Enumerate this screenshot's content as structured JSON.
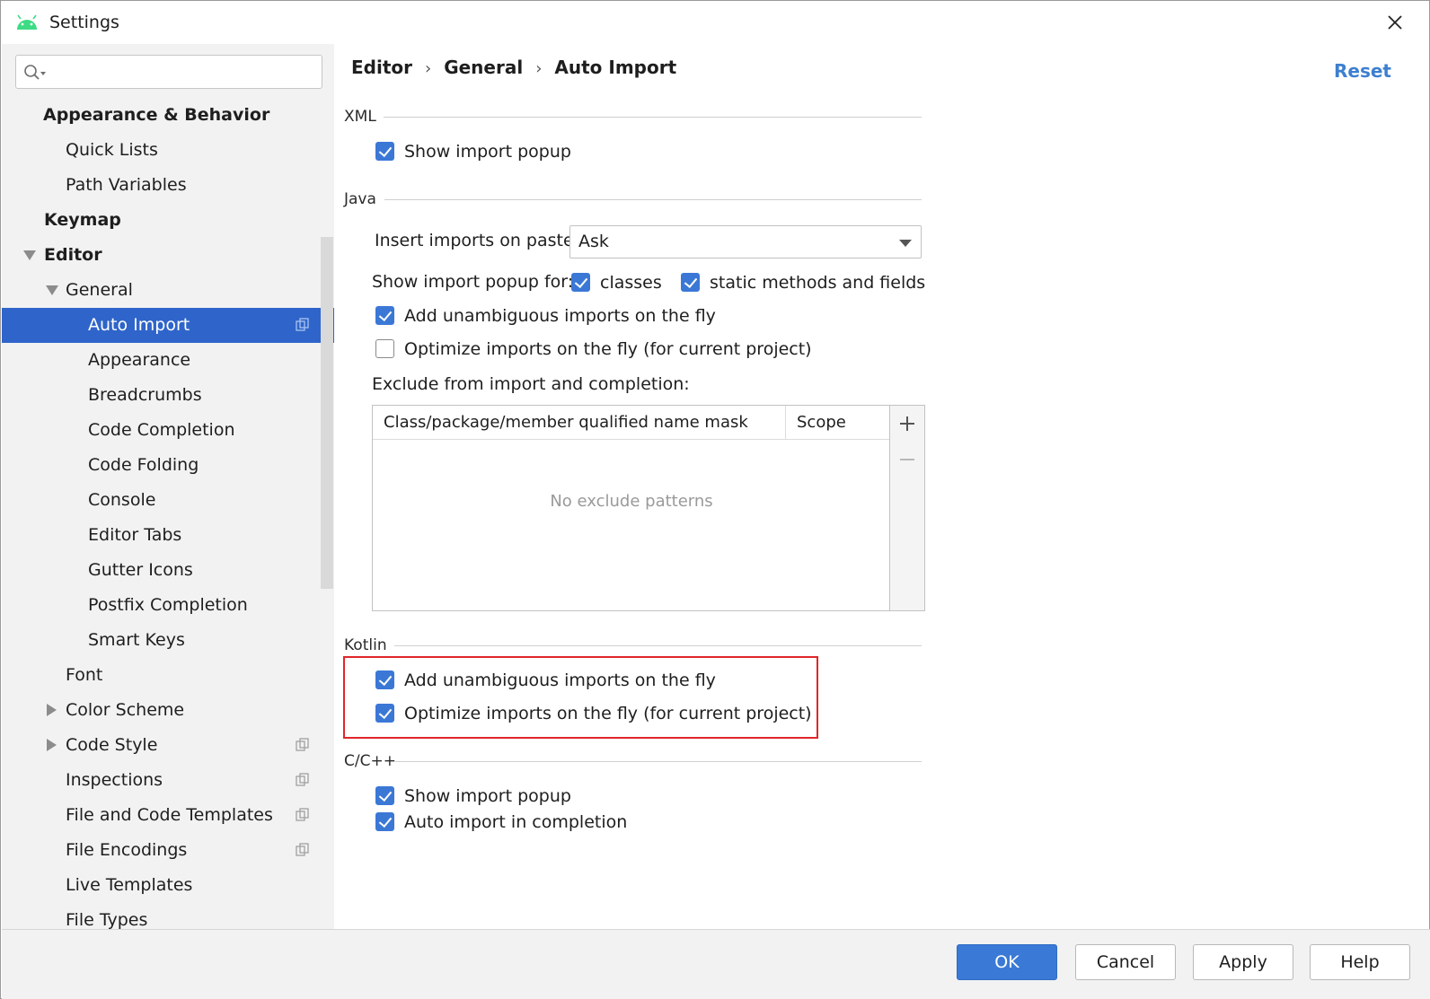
{
  "window": {
    "title": "Settings"
  },
  "search": {
    "value": "",
    "placeholder": ""
  },
  "sidebar": {
    "items": [
      {
        "label": "Appearance & Behavior"
      },
      {
        "label": "Quick Lists"
      },
      {
        "label": "Path Variables"
      },
      {
        "label": "Keymap"
      },
      {
        "label": "Editor"
      },
      {
        "label": "General"
      },
      {
        "label": "Auto Import"
      },
      {
        "label": "Appearance"
      },
      {
        "label": "Breadcrumbs"
      },
      {
        "label": "Code Completion"
      },
      {
        "label": "Code Folding"
      },
      {
        "label": "Console"
      },
      {
        "label": "Editor Tabs"
      },
      {
        "label": "Gutter Icons"
      },
      {
        "label": "Postfix Completion"
      },
      {
        "label": "Smart Keys"
      },
      {
        "label": "Font"
      },
      {
        "label": "Color Scheme"
      },
      {
        "label": "Code Style"
      },
      {
        "label": "Inspections"
      },
      {
        "label": "File and Code Templates"
      },
      {
        "label": "File Encodings"
      },
      {
        "label": "Live Templates"
      },
      {
        "label": "File Types"
      }
    ]
  },
  "breadcrumb": {
    "parts": [
      "Editor",
      "General",
      "Auto Import"
    ],
    "separator": "›"
  },
  "reset_label": "Reset",
  "xml": {
    "title": "XML",
    "show_import_popup": {
      "label": "Show import popup",
      "checked": true
    }
  },
  "java": {
    "title": "Java",
    "insert_on_paste_label": "Insert imports on paste:",
    "insert_on_paste_value": "Ask",
    "show_popup_for_label": "Show import popup for:",
    "classes": {
      "label": "classes",
      "checked": true
    },
    "static_methods": {
      "label": "static methods and fields",
      "checked": true
    },
    "add_unambiguous": {
      "label": "Add unambiguous imports on the fly",
      "checked": true
    },
    "optimize_imports": {
      "label": "Optimize imports on the fly (for current project)",
      "checked": false
    },
    "exclude_label": "Exclude from import and completion:",
    "table": {
      "columns": [
        "Class/package/member qualified name mask",
        "Scope"
      ],
      "empty_text": "No exclude patterns"
    }
  },
  "kotlin": {
    "title": "Kotlin",
    "add_unambiguous": {
      "label": "Add unambiguous imports on the fly",
      "checked": true
    },
    "optimize_imports": {
      "label": "Optimize imports on the fly (for current project)",
      "checked": true
    }
  },
  "cpp": {
    "title": "C/C++",
    "show_import_popup": {
      "label": "Show import popup",
      "checked": true
    },
    "auto_import_completion": {
      "label": "Auto import in completion",
      "checked": true
    }
  },
  "footer": {
    "ok": "OK",
    "cancel": "Cancel",
    "apply": "Apply",
    "help": "Help"
  },
  "colors": {
    "accent": "#2f65ca",
    "checkbox": "#3b78d6",
    "link": "#3d7fd0",
    "highlight": "#e0262a"
  }
}
